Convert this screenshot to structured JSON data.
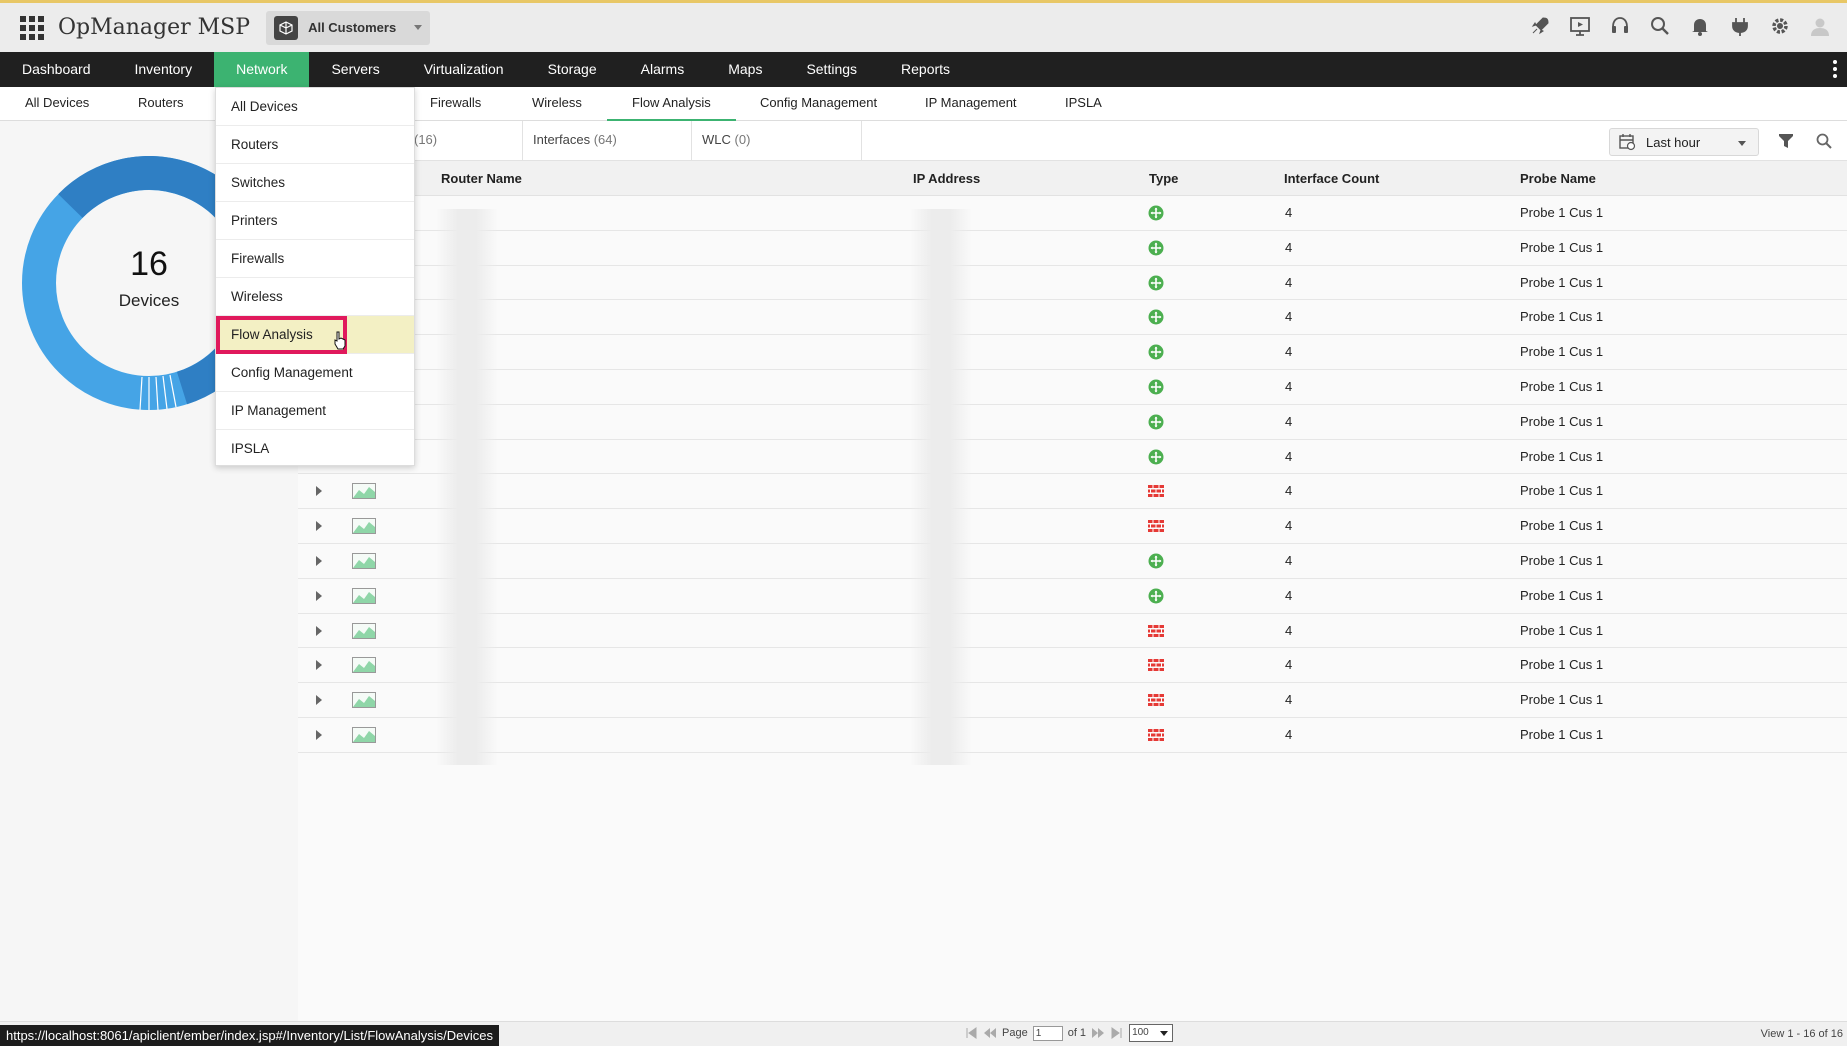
{
  "header": {
    "app_title": "OpManager MSP",
    "customer_select": "All Customers",
    "icons": [
      "rocket-icon",
      "presentation-icon",
      "headset-icon",
      "search-icon",
      "bell-icon",
      "plug-icon",
      "gear-icon",
      "avatar-icon"
    ]
  },
  "main_nav": {
    "items": [
      "Dashboard",
      "Inventory",
      "Network",
      "Servers",
      "Virtualization",
      "Storage",
      "Alarms",
      "Maps",
      "Settings",
      "Reports"
    ],
    "active": "Network"
  },
  "sub_nav": {
    "items": [
      "All Devices",
      "Routers",
      "Firewalls",
      "Wireless",
      "Flow Analysis",
      "Config Management",
      "IP Management",
      "IPSLA"
    ],
    "active": "Flow Analysis"
  },
  "summary": {
    "device_count": "16",
    "device_label": "Devices"
  },
  "device_tabs": [
    {
      "label": "",
      "count": "(16)"
    },
    {
      "label": "Interfaces",
      "count": "(64)"
    },
    {
      "label": "WLC",
      "count": "(0)"
    }
  ],
  "time_filter": "Last hour",
  "table": {
    "columns": [
      "Router Name",
      "IP Address",
      "Type",
      "Interface Count",
      "Probe Name"
    ],
    "rows": [
      {
        "type": "router",
        "interface_count": "4",
        "probe": "Probe 1 Cus 1"
      },
      {
        "type": "router",
        "interface_count": "4",
        "probe": "Probe 1 Cus 1"
      },
      {
        "type": "router",
        "interface_count": "4",
        "probe": "Probe 1 Cus 1"
      },
      {
        "type": "router",
        "interface_count": "4",
        "probe": "Probe 1 Cus 1"
      },
      {
        "type": "router",
        "interface_count": "4",
        "probe": "Probe 1 Cus 1"
      },
      {
        "type": "router",
        "interface_count": "4",
        "probe": "Probe 1 Cus 1"
      },
      {
        "type": "router",
        "interface_count": "4",
        "probe": "Probe 1 Cus 1"
      },
      {
        "type": "router",
        "interface_count": "4",
        "probe": "Probe 1 Cus 1"
      },
      {
        "type": "firewall",
        "interface_count": "4",
        "probe": "Probe 1 Cus 1"
      },
      {
        "type": "firewall",
        "interface_count": "4",
        "probe": "Probe 1 Cus 1"
      },
      {
        "type": "router",
        "interface_count": "4",
        "probe": "Probe 1 Cus 1"
      },
      {
        "type": "router",
        "interface_count": "4",
        "probe": "Probe 1 Cus 1"
      },
      {
        "type": "firewall",
        "interface_count": "4",
        "probe": "Probe 1 Cus 1"
      },
      {
        "type": "firewall",
        "interface_count": "4",
        "probe": "Probe 1 Cus 1"
      },
      {
        "type": "firewall",
        "interface_count": "4",
        "probe": "Probe 1 Cus 1"
      },
      {
        "type": "firewall",
        "interface_count": "4",
        "probe": "Probe 1 Cus 1"
      }
    ]
  },
  "dropdown": {
    "items": [
      "All Devices",
      "Routers",
      "Switches",
      "Printers",
      "Firewalls",
      "Wireless",
      "Flow Analysis",
      "Config Management",
      "IP Management",
      "IPSLA"
    ],
    "highlighted": "Flow Analysis"
  },
  "pager": {
    "page_label": "Page",
    "page_value": "1",
    "of_label": "of 1",
    "per_page": "100",
    "view_info": "View 1 - 16 of 16"
  },
  "status_url": "https://localhost:8061/apiclient/ember/index.jsp#/Inventory/List/FlowAnalysis/Devices",
  "colors": {
    "accent_green": "#3cb371",
    "nav_dark": "#202020",
    "highlight_border": "#e0195c",
    "router_icon": "#4caf50",
    "firewall_icon": "#e53935",
    "donut_light": "#45a4e6",
    "donut_dark": "#2f7fc4"
  }
}
